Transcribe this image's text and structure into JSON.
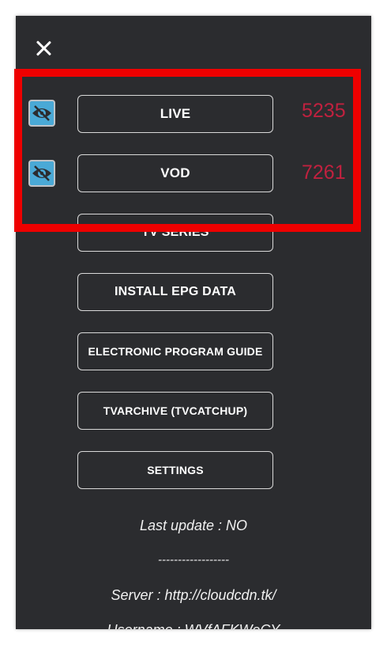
{
  "menu": {
    "live": {
      "label": "LIVE",
      "count": "5235"
    },
    "vod": {
      "label": "VOD",
      "count": "7261"
    },
    "tv_series": {
      "label": "TV SERIES"
    },
    "install_epg": {
      "label": "INSTALL EPG DATA"
    },
    "epg_guide": {
      "label": "ELECTRONIC PROGRAM GUIDE"
    },
    "tvarchive": {
      "label": "TVARCHIVE (TVCATCHUP)"
    },
    "settings": {
      "label": "SETTINGS"
    }
  },
  "info": {
    "last_update": "Last update : NO",
    "divider": "------------------",
    "server": "Server  :  http://cloudcdn.tk/",
    "username": "Username  :  WVfAFKWeCY"
  },
  "colors": {
    "background": "#2b2c2f",
    "count": "#c0213f",
    "highlight": "#ee0000",
    "eye_icon": "#4aa9d6"
  },
  "icons": {
    "close": "close-icon",
    "visibility": "eye-off-icon"
  }
}
